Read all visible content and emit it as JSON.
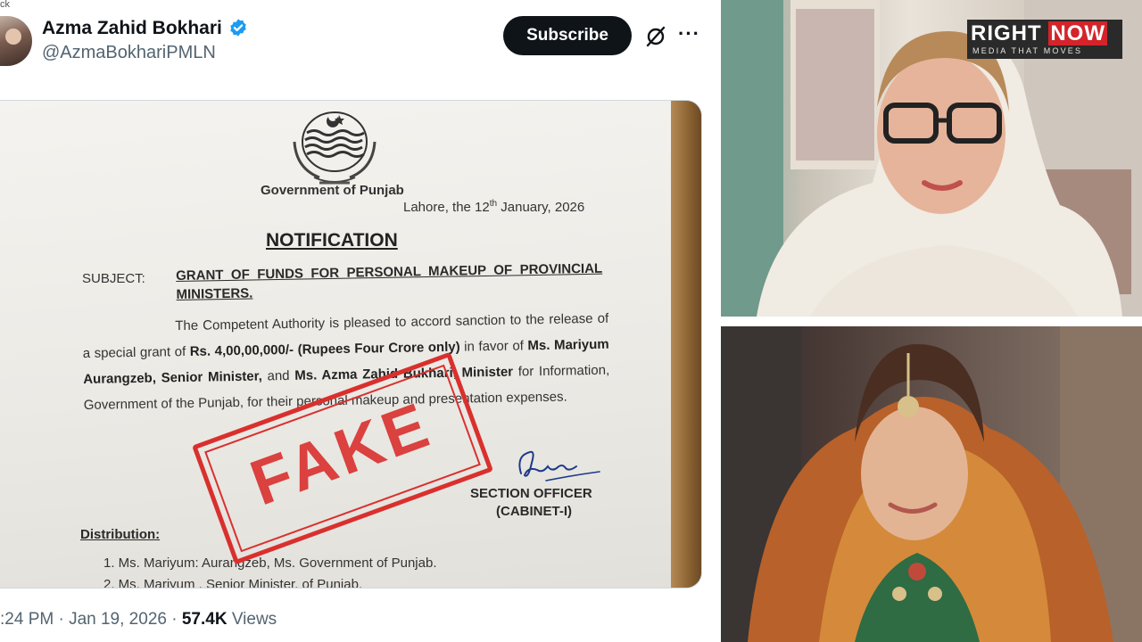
{
  "corner_fragment": "ck",
  "post": {
    "author_name": "Azma Zahid Bokhari",
    "author_handle": "@AzmaBokhariPMLN",
    "subscribe_label": "Subscribe",
    "more_label": "···",
    "timestamp": ":24 PM · Jan 19, 2026 ·",
    "views_count": "57.4K",
    "views_label": "Views"
  },
  "document": {
    "government": "Government of Punjab",
    "date_prefix": "Lahore, the 12",
    "date_sup": "th",
    "date_suffix": " January, 2026",
    "heading": "NOTIFICATION",
    "subject_label": "SUBJECT:",
    "subject_text": "GRANT OF FUNDS FOR PERSONAL MAKEUP OF PROVINCIAL MINISTERS.",
    "body_1": "The Competent Authority is pleased to accord sanction to the release of a special grant of ",
    "body_amount": "Rs. 4,00,00,000/- (Rupees Four Crore only)",
    "body_2": " in favor of ",
    "body_person_1": "Ms. Mariyum Aurangzeb, Senior Minister,",
    "body_3": " and ",
    "body_person_2": "Ms. Azma Zahid Bukhari, Minister",
    "body_4": " for Information, Government of the Punjab, for their personal makeup and presentation expenses.",
    "officer": "SECTION OFFICER",
    "cabinet": "(CABINET-I)",
    "distribution_label": "Distribution:",
    "distribution_items": [
      "1.   Ms. Mariyum: Aurangzeb, Ms. Government of Punjab.",
      "2.   Ms. Mariyum , Senior Minister, of Punjab."
    ],
    "stamp_text": "FAKE"
  },
  "watermark": {
    "brand_left": "RIGHT",
    "brand_right": "NOW",
    "tagline": "MEDIA THAT MOVES"
  },
  "colors": {
    "stamp_red": "#d9302e",
    "verified_blue": "#1d9bf0",
    "brand_red": "#d3242a"
  }
}
